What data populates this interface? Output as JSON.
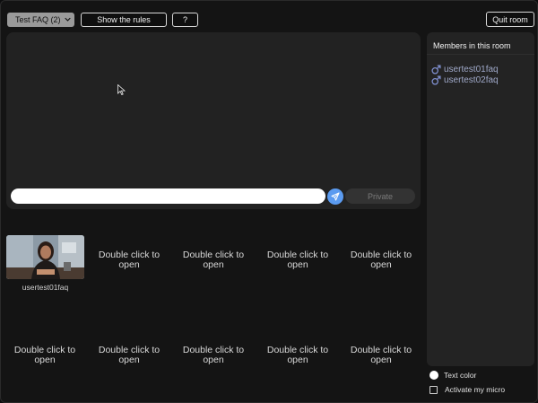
{
  "header": {
    "room_selected": "Test FAQ (2)",
    "rules_label": "Show the rules",
    "help_label": "?",
    "quit_label": "Quit room"
  },
  "chat": {
    "input_value": "",
    "input_placeholder": "",
    "private_label": "Private"
  },
  "members": {
    "title": "Members in this room",
    "items": [
      {
        "name": "usertest01faq",
        "icon": "male-icon"
      },
      {
        "name": "usertest02faq",
        "icon": "male-icon"
      }
    ]
  },
  "cams": {
    "active_caption": "usertest01faq",
    "empty_label": "Double click to open",
    "slots": [
      {
        "label": "Double click to open"
      },
      {
        "label": "Double click to open"
      },
      {
        "label": "Double click to open"
      },
      {
        "label": "Double click to open"
      },
      {
        "label": "Double click to open"
      },
      {
        "label": "Double click to open"
      },
      {
        "label": "Double click to open"
      },
      {
        "label": "Double click to open"
      },
      {
        "label": "Double click to open"
      }
    ]
  },
  "controls": {
    "text_color_label": "Text color",
    "text_color_value": "#ffffff",
    "micro_label": "Activate my micro",
    "micro_checked": false
  },
  "colors": {
    "accent_send": "#5b9bf0",
    "member_name": "#9fa8c8"
  }
}
